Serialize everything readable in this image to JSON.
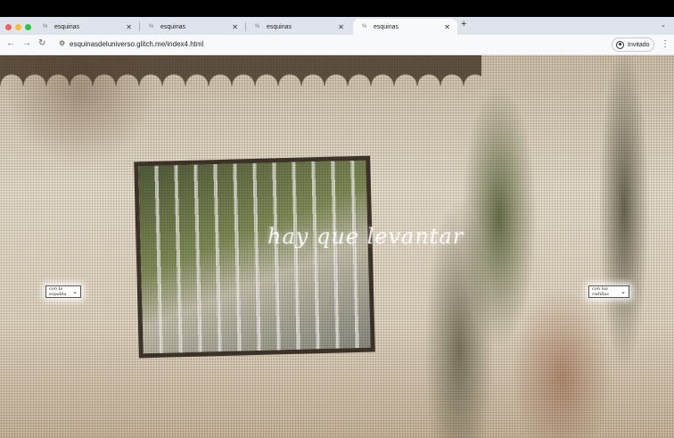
{
  "browser": {
    "tabs": [
      {
        "title": "esquinas",
        "active": false
      },
      {
        "title": "esquinas",
        "active": false
      },
      {
        "title": "esquinas",
        "active": false
      },
      {
        "title": "esquinas",
        "active": true
      }
    ],
    "close_glyph": "✕",
    "favicon_glyph": "%",
    "new_tab_glyph": "+",
    "tab_menu_glyph": "⌄",
    "url": "esquinasdeluniverso.glitch.me/index4.html",
    "profile_label": "Invitado",
    "traffic_colors": [
      "#ff5f57",
      "#febc2e",
      "#28c840"
    ]
  },
  "page": {
    "headline": "hay que levantar",
    "left_select": {
      "value": "con la espalda"
    },
    "right_select": {
      "value": "con las rodillas"
    }
  },
  "colors": {
    "tab_bg": "#dfe3eb",
    "toolbar_bg": "#f8f9fb"
  }
}
